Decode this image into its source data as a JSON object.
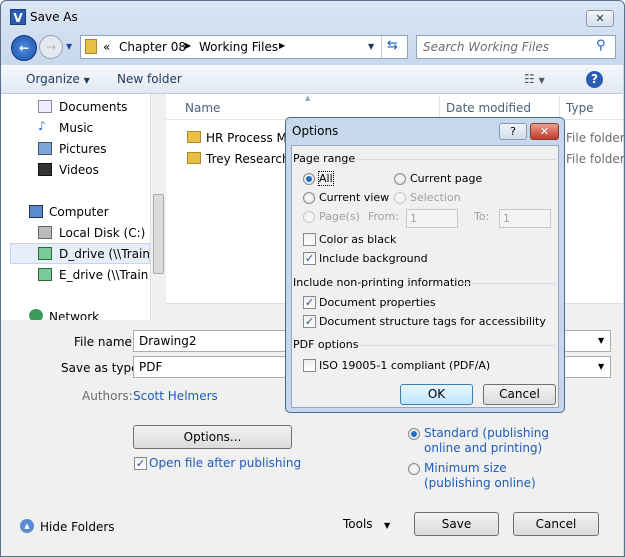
{
  "window": {
    "title": "Save As",
    "app_icon": "V",
    "close": "✕"
  },
  "address": {
    "overflow": "«",
    "crumbs": [
      "Chapter 08",
      "Working Files"
    ],
    "search_placeholder": "Search Working Files"
  },
  "toolbar": {
    "organize": "Organize",
    "new_folder": "New folder"
  },
  "nav": {
    "items": [
      "Documents",
      "Music",
      "Pictures",
      "Videos",
      "Computer",
      "Local Disk (C:)",
      "D_drive (\\\\Trainin",
      "E_drive (\\\\Trainin",
      "Network"
    ]
  },
  "columns": {
    "name": "Name",
    "date": "Date modified",
    "type": "Type"
  },
  "files": [
    {
      "name": "HR Process Ma",
      "type": "File folder"
    },
    {
      "name": "Trey Research",
      "type": "File folder"
    }
  ],
  "form": {
    "file_name_label": "File name:",
    "file_name": "Drawing2",
    "type_label": "Save as type:",
    "type": "PDF",
    "authors_label": "Authors:",
    "authors": "Scott Helmers",
    "options_button": "Options...",
    "open_after": "Open file after publishing",
    "open_after_checked": true,
    "standard": "Standard (publishing online and printing)",
    "minimum": "Minimum size (publishing online)",
    "optimize_selected": "standard"
  },
  "footer": {
    "hide_folders": "Hide Folders",
    "tools": "Tools",
    "save": "Save",
    "cancel": "Cancel"
  },
  "options_dialog": {
    "title": "Options",
    "help": "?",
    "close": "✕",
    "page_range": "Page range",
    "all": "All",
    "current_page": "Current page",
    "current_view": "Current view",
    "selection": "Selection",
    "pages": "Page(s)",
    "from_label": "From:",
    "from": "1",
    "to_label": "To:",
    "to": "1",
    "selected_range": "all",
    "color_as_black": "Color as black",
    "color_as_black_checked": false,
    "include_background": "Include background",
    "include_background_checked": true,
    "nonprinting": "Include non-printing information",
    "doc_props": "Document properties",
    "doc_props_checked": true,
    "doc_tags": "Document structure tags for accessibility",
    "doc_tags_checked": true,
    "pdf_options": "PDF options",
    "iso": "ISO 19005-1 compliant (PDF/A)",
    "iso_checked": false,
    "ok": "OK",
    "cancel": "Cancel"
  }
}
